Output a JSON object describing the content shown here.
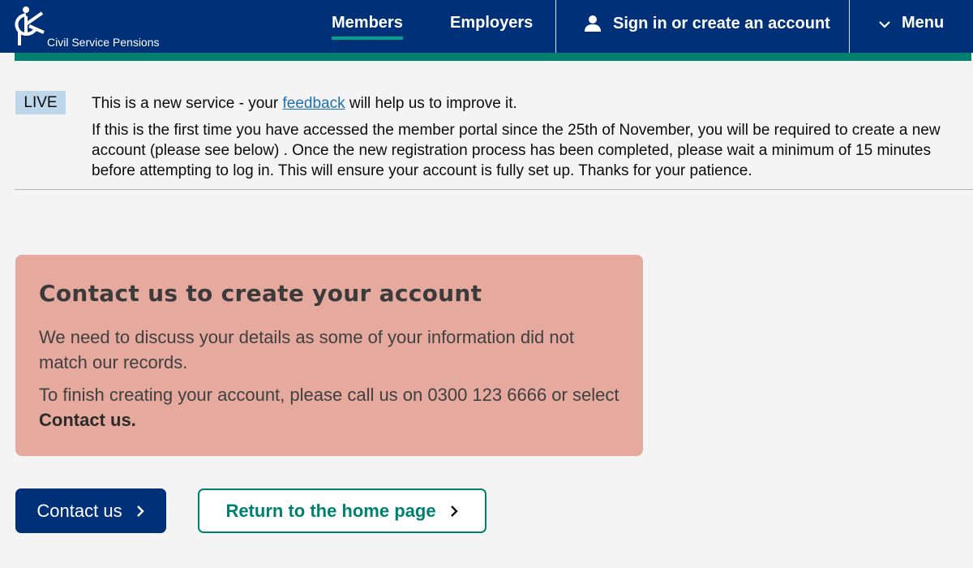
{
  "header": {
    "logo_text": "Civil Service Pensions",
    "nav": {
      "members": "Members",
      "employers": "Employers",
      "signin": "Sign in or create an account",
      "menu": "Menu"
    }
  },
  "banner": {
    "tag": "LIVE",
    "line1_before": "This is a new service - your ",
    "line1_link": "feedback",
    "line1_after": " will help us to improve it.",
    "line2": "If this is the first time you have accessed the member portal since the 25th of November, you will be required to create a new account (please see below) . Once the new registration process has been completed, please wait a minimum of 15 minutes before attempting to log in. This will ensure your account is fully set up. Thanks for your patience."
  },
  "panel": {
    "title": "Contact us to create your account",
    "para1": "We need to discuss your details as some of your information did not match our records.",
    "para2_before": "To finish creating your account, please call us on 0300 123 6666 or select ",
    "para2_bold": "Contact us."
  },
  "buttons": {
    "contact": "Contact us",
    "home": "Return to the home page"
  },
  "icons": {
    "user": "user-icon",
    "menu": "chevron-down-icon",
    "chevron": "chevron-right-icon"
  },
  "colors": {
    "header_bg": "#003078",
    "accent_green": "#00806f",
    "panel_bg": "#e6a99e",
    "live_tag_bg": "#bfd7ea",
    "link": "#1d70b8"
  }
}
